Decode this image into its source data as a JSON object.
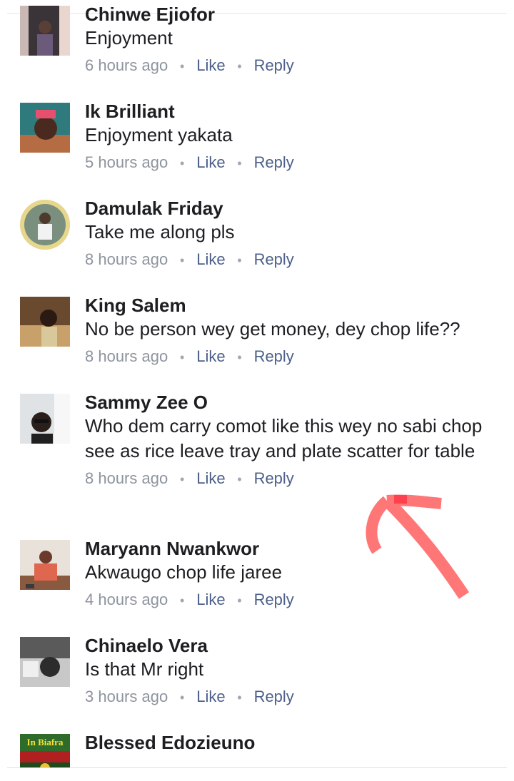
{
  "comments": [
    {
      "name": "Chinwe Ejiofor",
      "text": "Enjoyment",
      "time": "6 hours ago",
      "like": "Like",
      "reply": "Reply"
    },
    {
      "name": "Ik Brilliant",
      "text": "Enjoyment  yakata",
      "time": "5 hours ago",
      "like": "Like",
      "reply": "Reply"
    },
    {
      "name": "Damulak Friday",
      "text": "Take me along pls",
      "time": "8 hours ago",
      "like": "Like",
      "reply": "Reply"
    },
    {
      "name": "King Salem",
      "text": "No be person wey get money, dey chop life??",
      "time": "8 hours ago",
      "like": "Like",
      "reply": "Reply"
    },
    {
      "name": "Sammy Zee O",
      "text": "Who dem carry comot like this wey no sabi chop see as rice leave tray and plate scatter for table",
      "time": "8 hours ago",
      "like": "Like",
      "reply": "Reply"
    },
    {
      "name": "Maryann Nwankwor",
      "text": "Akwaugo chop life jaree",
      "time": "4 hours ago",
      "like": "Like",
      "reply": "Reply"
    },
    {
      "name": "Chinaelo Vera",
      "text": "Is that Mr right",
      "time": "3 hours ago",
      "like": "Like",
      "reply": "Reply"
    },
    {
      "name": "Blessed Edozieuno",
      "avatar_text": "In Biafra"
    }
  ],
  "dot": "•",
  "annotation": {
    "type": "red-arrow-icon",
    "color": "#ff6b6b"
  }
}
